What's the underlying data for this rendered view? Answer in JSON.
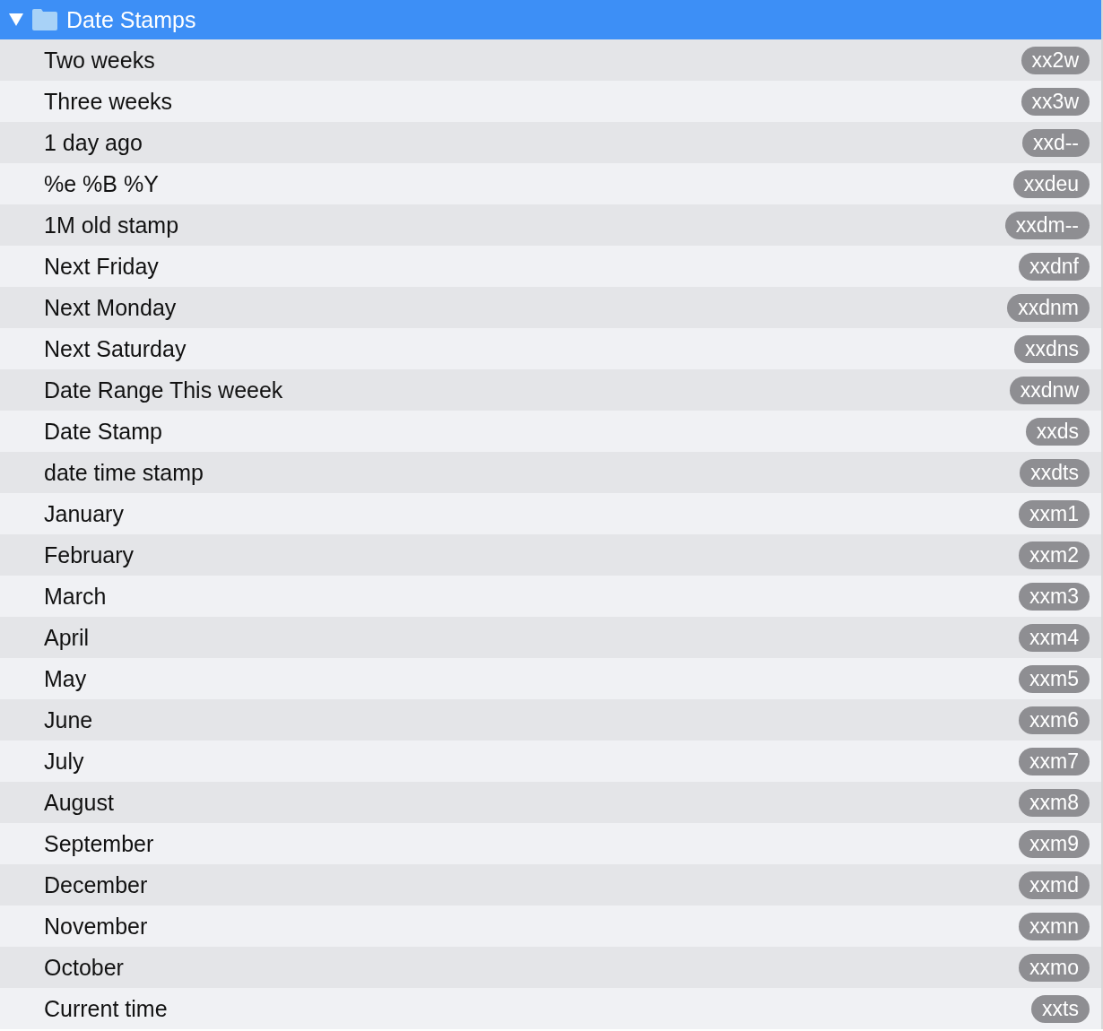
{
  "group": {
    "title": "Date Stamps",
    "expanded": true,
    "selected": true
  },
  "items": [
    {
      "name": "Two weeks",
      "abbreviation": "xx2w"
    },
    {
      "name": "Three weeks",
      "abbreviation": "xx3w"
    },
    {
      "name": "1 day ago",
      "abbreviation": "xxd--"
    },
    {
      "name": "%e %B %Y",
      "abbreviation": "xxdeu"
    },
    {
      "name": "1M old stamp",
      "abbreviation": "xxdm--"
    },
    {
      "name": "Next Friday",
      "abbreviation": "xxdnf"
    },
    {
      "name": "Next Monday",
      "abbreviation": "xxdnm"
    },
    {
      "name": "Next Saturday",
      "abbreviation": "xxdns"
    },
    {
      "name": "Date Range This weeek",
      "abbreviation": "xxdnw"
    },
    {
      "name": "Date Stamp",
      "abbreviation": "xxds"
    },
    {
      "name": "date time stamp",
      "abbreviation": "xxdts"
    },
    {
      "name": "January",
      "abbreviation": "xxm1"
    },
    {
      "name": "February",
      "abbreviation": "xxm2"
    },
    {
      "name": "March",
      "abbreviation": "xxm3"
    },
    {
      "name": "April",
      "abbreviation": "xxm4"
    },
    {
      "name": "May",
      "abbreviation": "xxm5"
    },
    {
      "name": "June",
      "abbreviation": "xxm6"
    },
    {
      "name": "July",
      "abbreviation": "xxm7"
    },
    {
      "name": "August",
      "abbreviation": "xxm8"
    },
    {
      "name": "September",
      "abbreviation": "xxm9"
    },
    {
      "name": "December",
      "abbreviation": "xxmd"
    },
    {
      "name": "November",
      "abbreviation": "xxmn"
    },
    {
      "name": "October",
      "abbreviation": "xxmo"
    },
    {
      "name": "Current time",
      "abbreviation": "xxts"
    }
  ]
}
